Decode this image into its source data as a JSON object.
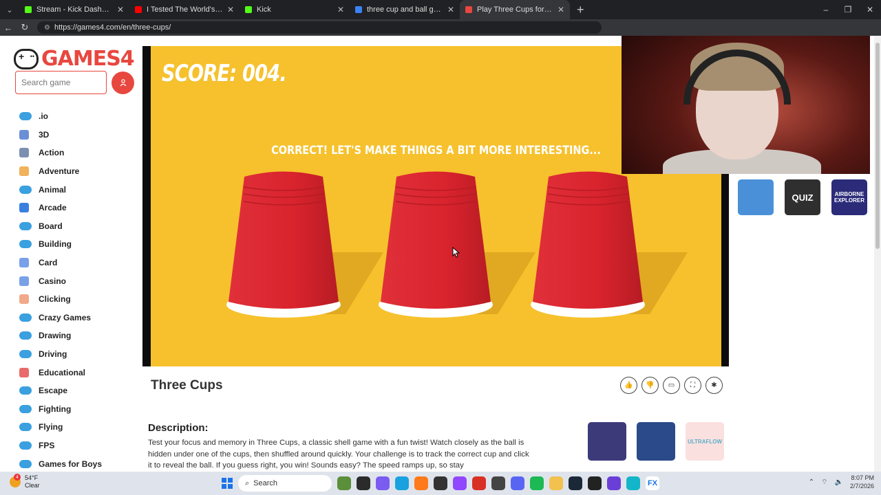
{
  "browser": {
    "tabs": [
      {
        "label": "Stream - Kick Dashboard",
        "color": "#53fc18",
        "active": false
      },
      {
        "label": "I Tested The World's Smartest Ape",
        "color": "#ff0000",
        "active": false
      },
      {
        "label": "Kick",
        "color": "#53fc18",
        "active": false
      },
      {
        "label": "three cup and ball game - Search",
        "color": "#3b82f6",
        "active": false
      },
      {
        "label": "Play Three Cups for Free",
        "color": "#e8473f",
        "active": true
      }
    ],
    "url": "https://games4.com/en/three-cups/"
  },
  "site": {
    "logo_text": "GAMES4",
    "search_placeholder": "Search game",
    "categories": [
      {
        "label": ".io",
        "icon": "gamepad-icon",
        "color": "#3aa0e0"
      },
      {
        "label": "3D",
        "icon": "cube-icon",
        "color": "#6a8fd8"
      },
      {
        "label": "Action",
        "icon": "swords-icon",
        "color": "#7d8fb0"
      },
      {
        "label": "Adventure",
        "icon": "map-icon",
        "color": "#f0b25a"
      },
      {
        "label": "Animal",
        "icon": "gamepad-icon",
        "color": "#3aa0e0"
      },
      {
        "label": "Arcade",
        "icon": "arcade-icon",
        "color": "#3a7fe0"
      },
      {
        "label": "Board",
        "icon": "gamepad-icon",
        "color": "#3aa0e0"
      },
      {
        "label": "Building",
        "icon": "gamepad-icon",
        "color": "#3aa0e0"
      },
      {
        "label": "Card",
        "icon": "cards-icon",
        "color": "#7aa0e8"
      },
      {
        "label": "Casino",
        "icon": "cards-icon",
        "color": "#7aa0e8"
      },
      {
        "label": "Clicking",
        "icon": "hand-icon",
        "color": "#f2a98a"
      },
      {
        "label": "Crazy Games",
        "icon": "gamepad-icon",
        "color": "#3aa0e0"
      },
      {
        "label": "Drawing",
        "icon": "gamepad-icon",
        "color": "#3aa0e0"
      },
      {
        "label": "Driving",
        "icon": "gamepad-icon",
        "color": "#3aa0e0"
      },
      {
        "label": "Educational",
        "icon": "brain-icon",
        "color": "#e86a6a"
      },
      {
        "label": "Escape",
        "icon": "gamepad-icon",
        "color": "#3aa0e0"
      },
      {
        "label": "Fighting",
        "icon": "gamepad-icon",
        "color": "#3aa0e0"
      },
      {
        "label": "Flying",
        "icon": "gamepad-icon",
        "color": "#3aa0e0"
      },
      {
        "label": "FPS",
        "icon": "gamepad-icon",
        "color": "#3aa0e0"
      },
      {
        "label": "Games for Boys",
        "icon": "gamepad-icon",
        "color": "#3aa0e0"
      }
    ]
  },
  "game": {
    "score_text": "SCORE: 004.",
    "message": "CORRECT! LET'S MAKE THINGS A BIT MORE INTERESTING...",
    "title": "Three Cups",
    "cup_color": "#d9232d",
    "bg_color": "#f6c12c"
  },
  "actions": [
    "thumbs-up-icon",
    "thumbs-down-icon",
    "comment-icon",
    "fullscreen-icon",
    "bug-icon"
  ],
  "description": {
    "heading": "Description:",
    "text": "Test your focus and memory in Three Cups, a classic shell game with a fun twist! Watch closely as the ball is hidden under one of the cups, then shuffled around quickly. Your challenge is to track the correct cup and click it to reveal the ball. If you guess right, you win! Sounds easy? The speed ramps up, so stay"
  },
  "related_top": [
    {
      "name": "dirt-bike-game",
      "bg": "#4a90d9",
      "text": ""
    },
    {
      "name": "quiz-game",
      "bg": "#2f2f2f",
      "text": "QUIZ"
    },
    {
      "name": "airborne-explorer-game",
      "bg": "#2b2b7a",
      "text": "AIRBORNE EXPLORER"
    }
  ],
  "related_bottom": [
    {
      "name": "pixel-fox-game",
      "bg": "#3d3a7a",
      "text": ""
    },
    {
      "name": "moto-racing-game",
      "bg": "#2a4a8a",
      "text": ""
    },
    {
      "name": "ultraflow-game",
      "bg": "#fbe0e0",
      "text": "ULTRAFLOW"
    }
  ],
  "taskbar": {
    "temp": "54°F",
    "weather": "Clear",
    "weather_badge": "4",
    "search_label": "Search",
    "time": "8:07 PM",
    "date": "2/7/2026"
  }
}
